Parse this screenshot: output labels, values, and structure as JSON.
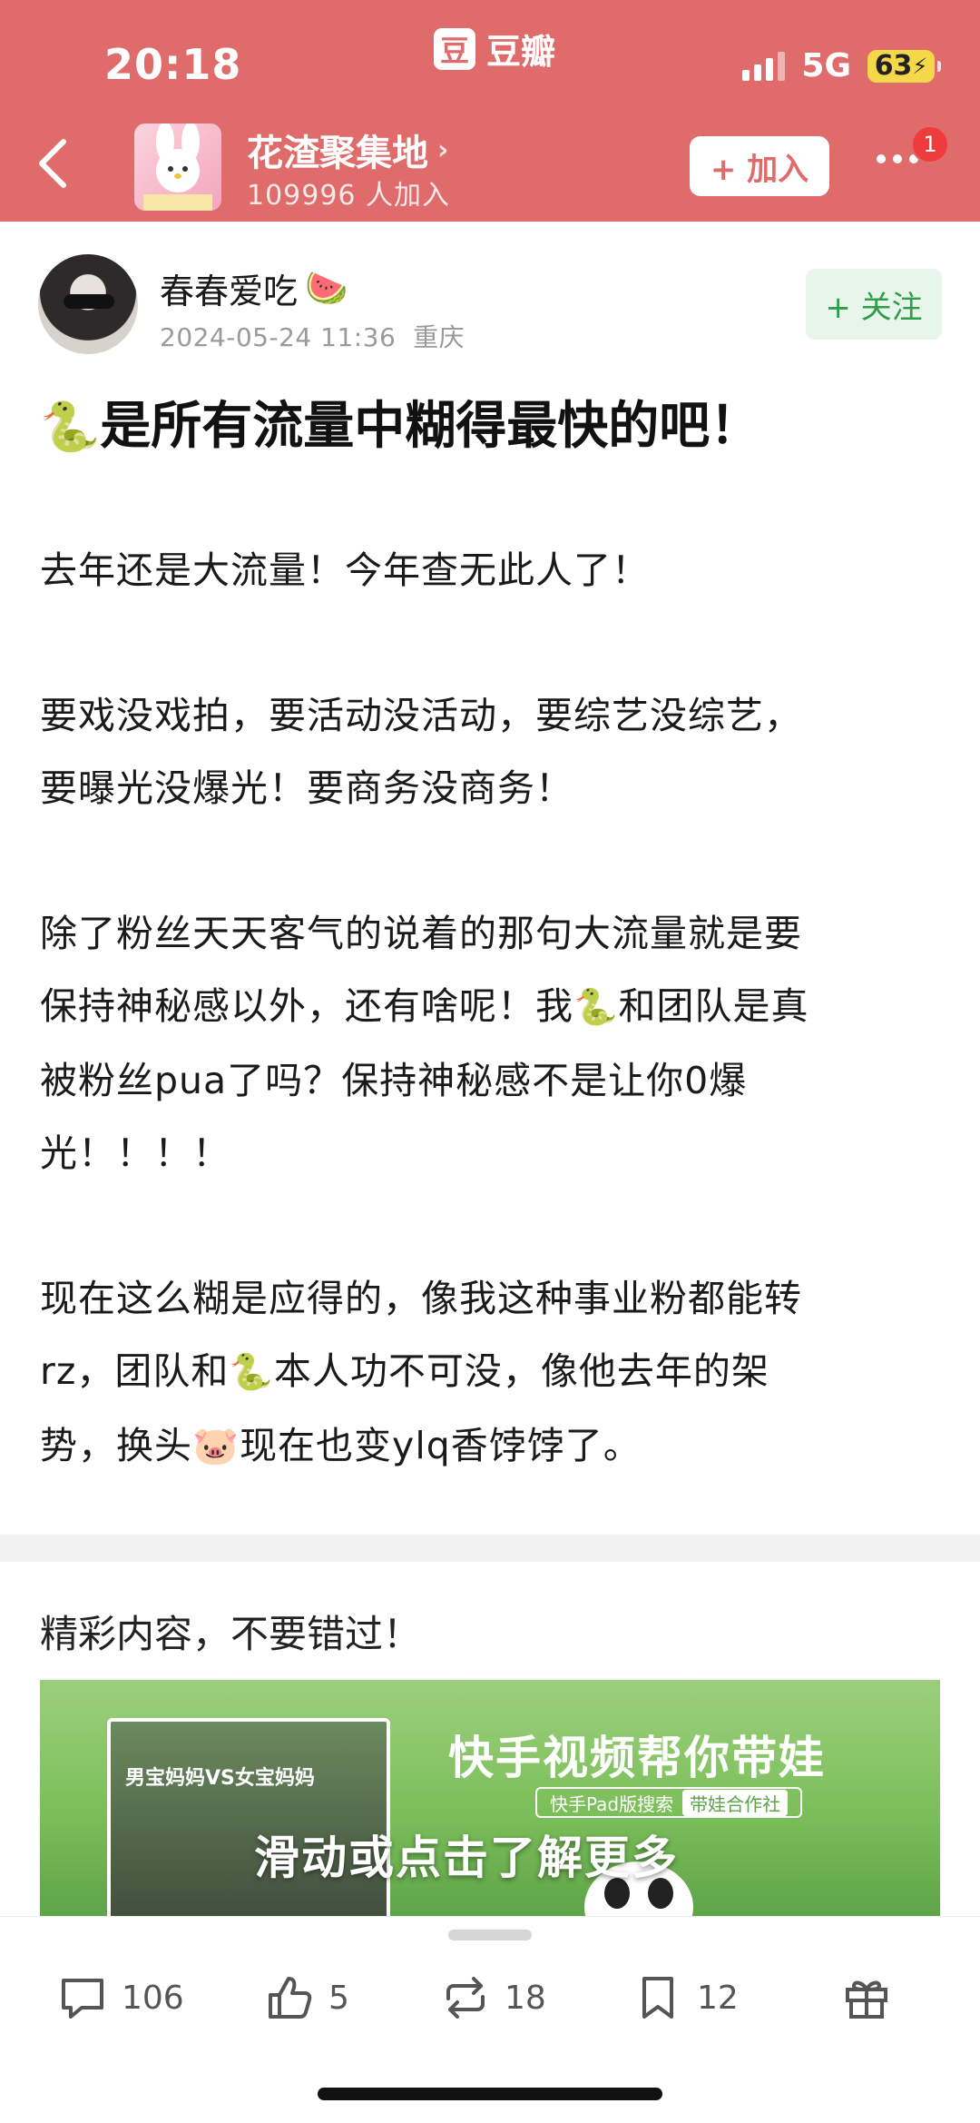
{
  "status_bar": {
    "time": "20:18",
    "network": "5G",
    "battery": "63"
  },
  "app": {
    "logo_char": "豆",
    "name": "豆瓣"
  },
  "group": {
    "name": "花渣聚集地",
    "member_count": "109996 人加入",
    "join_label": "+ 加入",
    "notification_count": "1"
  },
  "author": {
    "name": "春春爱吃",
    "name_emoji": "🍉",
    "date": "2024-05-24 11:36",
    "location": "重庆",
    "follow_label": "+ 关注"
  },
  "post": {
    "title_emoji": "🐍",
    "title": "是所有流量中糊得最快的吧！",
    "p1": "去年还是大流量！今年查无此人了！",
    "p2": "要戏没戏拍，要活动没活动，要综艺没综艺，\n要曝光没爆光！要商务没商务！",
    "p3_a": "除了粉丝天天客气的说着的那句大流量就是要\n保持神秘感以外，还有啥呢！我",
    "p3_emoji": "🐍",
    "p3_b": "和团队是真\n被粉丝pua了吗？保持神秘感不是让你0爆\n光！！！！",
    "p4_a": "现在这么糊是应得的，像我这种事业粉都能转\nrz，团队和",
    "p4_emoji1": "🐍",
    "p4_b": "本人功不可没，像他去年的架\n势，换头",
    "p4_emoji2": "🐷",
    "p4_c": "现在也变ylq香饽饽了。"
  },
  "promo": {
    "heading": "精彩内容，不要错过！",
    "thumb_label": "男宝妈妈VS女宝妈妈",
    "title": "快手视频帮你带娃",
    "search_tag": "快手Pad版搜索",
    "search_chip": "带娃合作社",
    "overlay": "滑动或点击了解更多"
  },
  "actions": {
    "comments": "106",
    "likes": "5",
    "reshares": "18",
    "saves": "12"
  },
  "colors": {
    "header": "#df6b6b",
    "follow": "#2f9e48",
    "battery": "#f5d84a"
  }
}
